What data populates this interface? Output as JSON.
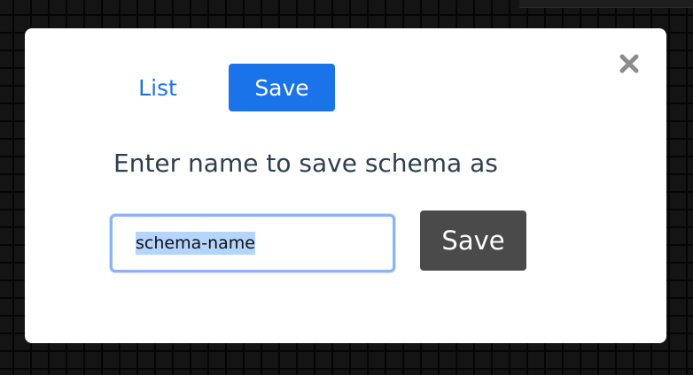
{
  "modal": {
    "tabs": [
      {
        "label": "List",
        "active": false
      },
      {
        "label": "Save",
        "active": true
      }
    ],
    "close_icon": "close-icon",
    "prompt": "Enter name to save schema as",
    "name_input": {
      "value": "schema-name",
      "selected": true
    },
    "submit_label": "Save"
  },
  "colors": {
    "accent": "#1a73e8",
    "submit_button": "#4a4a4a",
    "prompt_text": "#2c3e50",
    "backdrop": "#141414",
    "selection_highlight": "#b4d5fe"
  }
}
